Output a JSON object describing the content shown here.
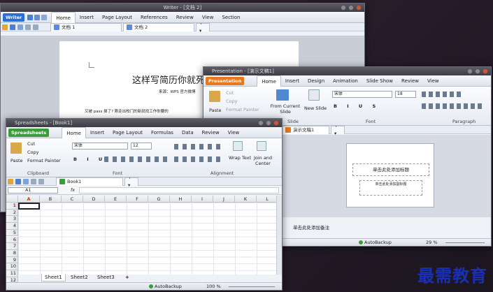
{
  "writer": {
    "title": "Writer - [文档 2]",
    "app_label": "Writer",
    "menus": [
      "Home",
      "Insert",
      "Page Layout",
      "References",
      "Review",
      "View",
      "Section"
    ],
    "tabs": [
      "文档 1",
      "文档 2"
    ],
    "doc_title": "这样写简历你就死",
    "doc_sub": "来源：WPS 官方微博",
    "doc_body": "又被 pass 掉了? 刚走出校门的新就找工作你要的"
  },
  "presentation": {
    "title": "Presentation - [演示文稿1]",
    "app_label": "Presentation",
    "menus": [
      "Home",
      "Insert",
      "Design",
      "Animation",
      "Slide Show",
      "Review",
      "View"
    ],
    "clipboard": {
      "cut": "Cut",
      "copy": "Copy",
      "format": "Format Painter",
      "paste": "Paste"
    },
    "from_current": "From Current Slide",
    "new_slide": "New Slide",
    "slide_group": "Slide",
    "font_group": "Font",
    "para_group": "Paragraph",
    "font_name": "宋体",
    "font_size": "18",
    "tab": "演示文稿1",
    "slide_title": "单击此处添加标题",
    "slide_sub": "单击此处添加副标题",
    "notes": "单击此处添加备注",
    "autobackup": "AutoBackup",
    "zoom": "29 %"
  },
  "spreadsheet": {
    "title": "Spreadsheets - [Book1]",
    "app_label": "Spreadsheets",
    "menus": [
      "Home",
      "Insert",
      "Page Layout",
      "Formulas",
      "Data",
      "Review",
      "View"
    ],
    "clipboard": {
      "cut": "Cut",
      "copy": "Copy",
      "format": "Format Painter",
      "paste": "Paste",
      "group": "Clipboard"
    },
    "font_name": "宋体",
    "font_size": "12",
    "font_group": "Font",
    "align_group": "Alignment",
    "wrap": "Wrap Text",
    "join": "Join and Center",
    "tab": "Book1",
    "namebox": "A1",
    "fx": "fx",
    "columns": [
      "A",
      "B",
      "C",
      "D",
      "E",
      "F",
      "G",
      "H",
      "I",
      "J",
      "K",
      "L"
    ],
    "rows": [
      "1",
      "2",
      "3",
      "4",
      "5",
      "6",
      "7",
      "8",
      "9",
      "10",
      "11",
      "12"
    ],
    "sheets": [
      "Sheet1",
      "Sheet2",
      "Sheet3"
    ],
    "autobackup": "AutoBackup",
    "zoom": "100 %"
  },
  "watermark": "最需教育",
  "colors": {
    "writer": "#2b6fd6",
    "presentation": "#e8781f",
    "spreadsheet": "#3c9b3c",
    "accent": "#c23a1f"
  }
}
